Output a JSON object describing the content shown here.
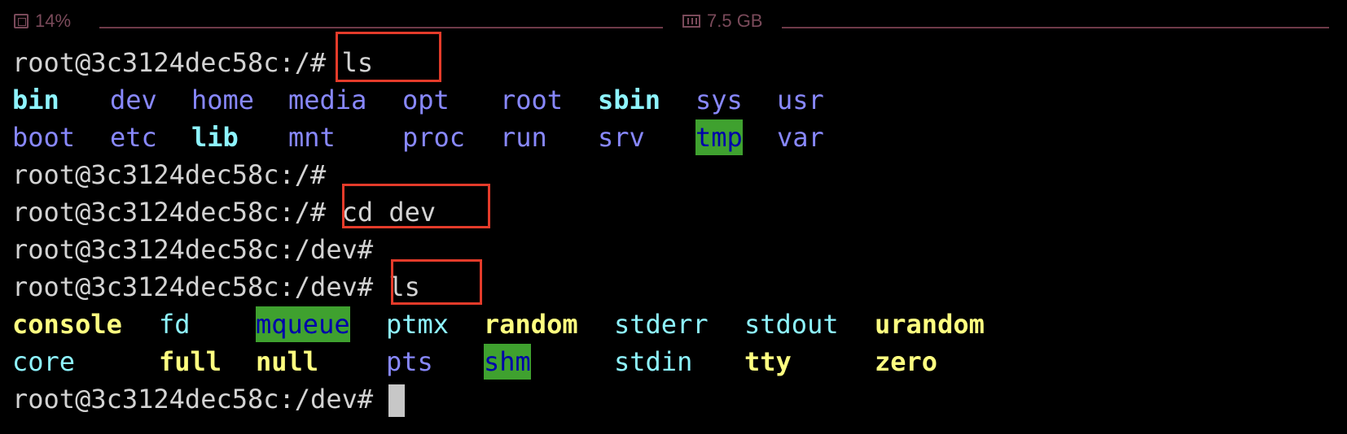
{
  "status_bar": {
    "cpu_label": "14%",
    "cpu_icon": "cpu-icon",
    "memory_label": "7.5 GB",
    "memory_icon": "memory-icon"
  },
  "terminal": {
    "lines": [
      {
        "prompt": "root@3c3124dec58c:/# ",
        "command": "ls"
      },
      {
        "prompt": "root@3c3124dec58c:/#",
        "command": ""
      },
      {
        "prompt": "root@3c3124dec58c:/# ",
        "command": "cd dev"
      },
      {
        "prompt": "root@3c3124dec58c:/dev#",
        "command": ""
      },
      {
        "prompt": "root@3c3124dec58c:/dev# ",
        "command": "ls"
      },
      {
        "prompt": "root@3c3124dec58c:/dev# ",
        "command": ""
      }
    ],
    "root_listing": [
      [
        "bin",
        "dev",
        "home",
        "media",
        "opt",
        "root",
        "sbin",
        "sys",
        "usr"
      ],
      [
        "boot",
        "etc",
        "lib",
        "mnt",
        "proc",
        "run",
        "srv",
        "tmp",
        "var"
      ]
    ],
    "dev_listing": [
      [
        "console",
        "fd",
        "mqueue",
        "ptmx",
        "random",
        "stderr",
        "stdout",
        "urandom"
      ],
      [
        "core",
        "full",
        "null",
        "pts",
        "shm",
        "stdin",
        "tty",
        "zero"
      ]
    ]
  },
  "colors": {
    "directory": "#8888ff",
    "symlink": "#8ef4ff",
    "device": "#ffff80",
    "sticky_bg": "#3fa12f",
    "annotation_box": "#e43b2a",
    "status_text": "#7a4a5a"
  }
}
